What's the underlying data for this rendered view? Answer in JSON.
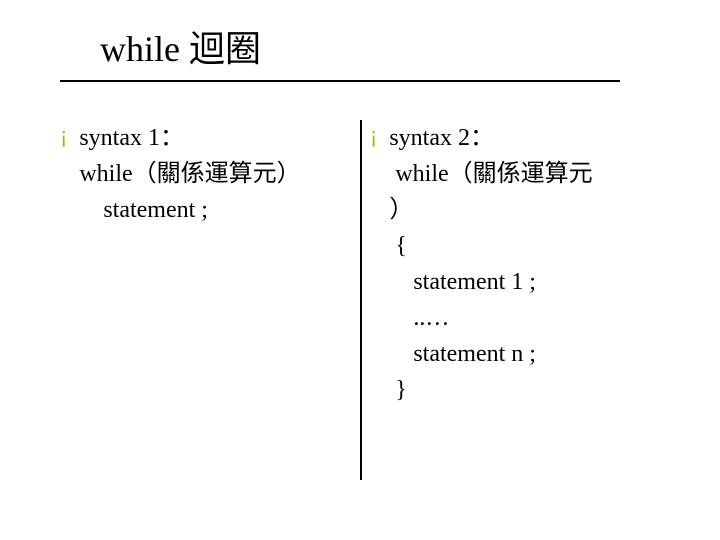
{
  "title": "while 迴圈",
  "left": {
    "l1": "syntax 1：",
    "l2": "while（關係運算元）",
    "l3": "    statement ;"
  },
  "right": {
    "l1": "syntax 2：",
    "l2": " while（關係運算元",
    "l3": "）",
    "l4": " {",
    "l5": "    statement 1 ;",
    "l6": "    ..…",
    "l7": "    statement n ;",
    "l8": " }"
  },
  "bullet_glyph": "¡"
}
